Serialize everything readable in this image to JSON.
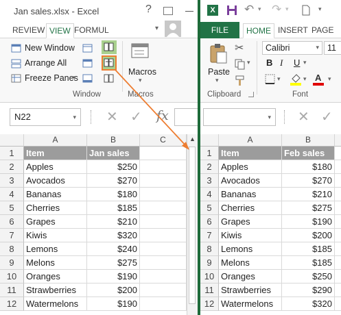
{
  "left": {
    "title": "Jan sales.xlsx - Excel",
    "tabs": [
      "REVIEW",
      "VIEW",
      "FORMUL"
    ],
    "ribbon": {
      "new_window": "New Window",
      "arrange_all": "Arrange All",
      "freeze_panes": "Freeze Panes",
      "macros": "Macros",
      "group_window": "Window",
      "group_macros": "Macros"
    },
    "name_box": "N22",
    "fx": "fx",
    "columns": [
      "A",
      "B",
      "C"
    ],
    "rows": [
      "1",
      "2",
      "3",
      "4",
      "5",
      "6",
      "7",
      "8",
      "9",
      "10",
      "11",
      "12"
    ],
    "header": [
      "Item",
      "Jan sales"
    ],
    "data": [
      [
        "Apples",
        "$250"
      ],
      [
        "Avocados",
        "$270"
      ],
      [
        "Bananas",
        "$180"
      ],
      [
        "Cherries",
        "$185"
      ],
      [
        "Grapes",
        "$210"
      ],
      [
        "Kiwis",
        "$320"
      ],
      [
        "Lemons",
        "$240"
      ],
      [
        "Melons",
        "$275"
      ],
      [
        "Oranges",
        "$190"
      ],
      [
        "Strawberries",
        "$200"
      ],
      [
        "Watermelons",
        "$190"
      ]
    ]
  },
  "right": {
    "tabs": [
      "FILE",
      "HOME",
      "INSERT",
      "PAGE LA"
    ],
    "ribbon": {
      "paste": "Paste",
      "font_name": "Calibri",
      "font_size": "11",
      "group_clipboard": "Clipboard",
      "group_font": "Font",
      "bold": "B",
      "italic": "I",
      "underline": "U"
    },
    "columns": [
      "A",
      "B"
    ],
    "rows": [
      "1",
      "2",
      "3",
      "4",
      "5",
      "6",
      "7",
      "8",
      "9",
      "10",
      "11",
      "12"
    ],
    "header": [
      "Item",
      "Feb sales"
    ],
    "data": [
      [
        "Apples",
        "$180"
      ],
      [
        "Avocados",
        "$270"
      ],
      [
        "Bananas",
        "$210"
      ],
      [
        "Cherries",
        "$275"
      ],
      [
        "Grapes",
        "$190"
      ],
      [
        "Kiwis",
        "$200"
      ],
      [
        "Lemons",
        "$185"
      ],
      [
        "Melons",
        "$185"
      ],
      [
        "Oranges",
        "$250"
      ],
      [
        "Strawberries",
        "$290"
      ],
      [
        "Watermelons",
        "$320"
      ]
    ]
  },
  "colors": {
    "excel_green": "#217346",
    "header_fill": "#9c9c9c",
    "arrow": "#ed7d31",
    "highlight": "#a9d08e"
  }
}
